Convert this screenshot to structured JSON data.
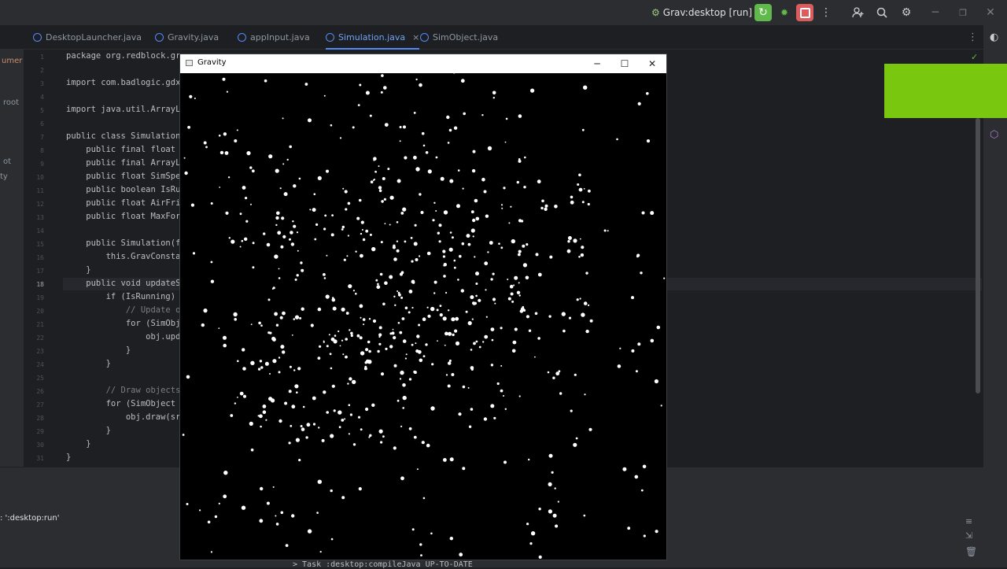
{
  "toolbar": {
    "run_config": "Grav:desktop [run]",
    "icons": [
      "people-icon",
      "search-icon",
      "gear-icon"
    ],
    "run_color": "#5fb94b",
    "stop_color": "#db5c5c"
  },
  "tabs": [
    {
      "label": "DesktopLauncher.java"
    },
    {
      "label": "Gravity.java"
    },
    {
      "label": "appInput.java"
    },
    {
      "label": "Simulation.java",
      "close": "×"
    },
    {
      "label": "SimObject.java"
    }
  ],
  "side_panel": {
    "labels": [
      "umer",
      "root",
      "ot",
      "ty"
    ]
  },
  "editor": {
    "line_numbers": [
      "1",
      "2",
      "3",
      "4",
      "5",
      "6",
      "7",
      "8",
      "9",
      "10",
      "11",
      "12",
      "13",
      "14",
      "15",
      "16",
      "17",
      "18",
      "19",
      "20",
      "21",
      "22",
      "23",
      "24",
      "25",
      "26",
      "27",
      "28",
      "29",
      "30",
      "31"
    ],
    "current_line": "18",
    "lines": [
      "package org.redblock.gr",
      "",
      "import com.badlogic.gdx",
      "",
      "import java.util.ArrayLi",
      "",
      "public class Simulation",
      "    public final float",
      "    public final ArrayL",
      "    public float SimSpe",
      "    public boolean IsRu",
      "    public float AirFri",
      "    public float MaxFor",
      "",
      "    public Simulation(f",
      "        this.GravConstar",
      "    }",
      "    public void updateS",
      "        if (IsRunning) {",
      "            // Update ol",
      "            for (SimObj",
      "                obj.upd",
      "            }",
      "        }",
      "",
      "        // Draw objects",
      "        for (SimObject c",
      "            obj.draw(sr",
      "        }",
      "    }",
      "}"
    ]
  },
  "bottom": {
    "run_tab": ": ':desktop:run'",
    "console_line": "> Task :desktop:compileJava UP-TO-DATE"
  },
  "gravity_window": {
    "title": "Gravity",
    "minimize": "─",
    "maximize": "☐",
    "close": "✕",
    "particle_color": "#ffffff",
    "background": "#000000"
  },
  "accent_green": "#79c70f"
}
